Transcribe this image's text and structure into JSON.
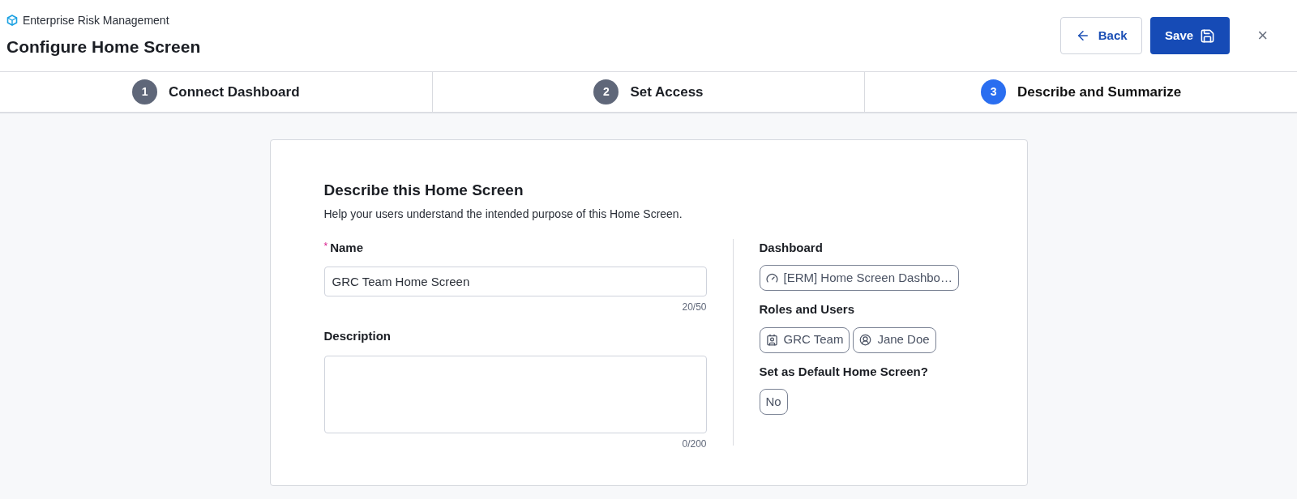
{
  "header": {
    "app_name": "Enterprise Risk Management",
    "title": "Configure Home Screen",
    "buttons": [
      {
        "kind": "back",
        "label": "Back"
      },
      {
        "kind": "save",
        "label": "Save"
      }
    ],
    "close": "×"
  },
  "steps": [
    {
      "number": "1",
      "label": "Connect Dashboard",
      "selected": false
    },
    {
      "number": "2",
      "label": "Set Access",
      "selected": false
    },
    {
      "number": "3",
      "label": "Describe and Summarize",
      "selected": true
    }
  ],
  "form": {
    "heading": "Describe this Home Screen",
    "subheading": "Help your users understand the intended purpose of this Home Screen.",
    "fields": [
      {
        "kind": "input",
        "label": "Name",
        "required_mark": "*",
        "value": "GRC Team Home Screen",
        "counter": "20/50"
      },
      {
        "kind": "textarea",
        "label": "Description",
        "counter": "0/200"
      }
    ]
  },
  "summary": [
    {
      "label": "Dashboard",
      "chips": [
        {
          "kind": "dashboard",
          "text": "[ERM] Home Screen Dashbo…"
        }
      ]
    },
    {
      "label": "Roles and Users",
      "chips": [
        {
          "kind": "role",
          "text": "GRC Team"
        },
        {
          "kind": "user",
          "text": "Jane Doe"
        }
      ]
    },
    {
      "label": "Set as Default Home Screen?",
      "chips": [
        {
          "kind": "plain",
          "text": "No"
        }
      ]
    }
  ]
}
